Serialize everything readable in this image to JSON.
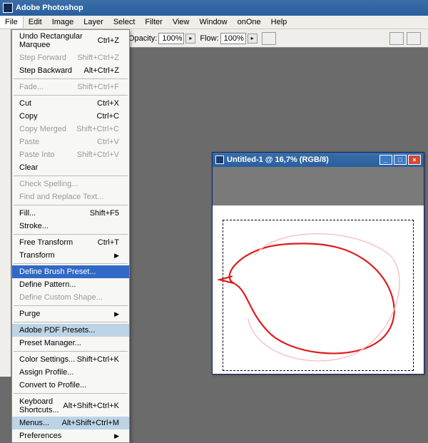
{
  "titlebar": {
    "app_name": "Adobe Photoshop"
  },
  "menubar": {
    "items": [
      "File",
      "Edit",
      "Image",
      "Layer",
      "Select",
      "Filter",
      "View",
      "Window",
      "onOne",
      "Help"
    ]
  },
  "options_bar": {
    "opacity_label": "Opacity:",
    "opacity_value": "100%",
    "flow_label": "Flow:",
    "flow_value": "100%"
  },
  "edit_menu": {
    "items": [
      {
        "label": "Undo Rectangular Marquee",
        "shortcut": "Ctrl+Z",
        "state": "normal"
      },
      {
        "label": "Step Forward",
        "shortcut": "Shift+Ctrl+Z",
        "state": "disabled"
      },
      {
        "label": "Step Backward",
        "shortcut": "Alt+Ctrl+Z",
        "state": "normal"
      },
      {
        "sep": true
      },
      {
        "label": "Fade...",
        "shortcut": "Shift+Ctrl+F",
        "state": "disabled"
      },
      {
        "sep": true
      },
      {
        "label": "Cut",
        "shortcut": "Ctrl+X",
        "state": "normal"
      },
      {
        "label": "Copy",
        "shortcut": "Ctrl+C",
        "state": "normal"
      },
      {
        "label": "Copy Merged",
        "shortcut": "Shift+Ctrl+C",
        "state": "disabled"
      },
      {
        "label": "Paste",
        "shortcut": "Ctrl+V",
        "state": "disabled"
      },
      {
        "label": "Paste Into",
        "shortcut": "Shift+Ctrl+V",
        "state": "disabled"
      },
      {
        "label": "Clear",
        "shortcut": "",
        "state": "normal"
      },
      {
        "sep": true
      },
      {
        "label": "Check Spelling...",
        "shortcut": "",
        "state": "disabled"
      },
      {
        "label": "Find and Replace Text...",
        "shortcut": "",
        "state": "disabled"
      },
      {
        "sep": true
      },
      {
        "label": "Fill...",
        "shortcut": "Shift+F5",
        "state": "normal"
      },
      {
        "label": "Stroke...",
        "shortcut": "",
        "state": "normal"
      },
      {
        "sep": true
      },
      {
        "label": "Free Transform",
        "shortcut": "Ctrl+T",
        "state": "normal"
      },
      {
        "label": "Transform",
        "shortcut": "",
        "state": "normal",
        "submenu": true
      },
      {
        "sep": true
      },
      {
        "label": "Define Brush Preset...",
        "shortcut": "",
        "state": "selected"
      },
      {
        "label": "Define Pattern...",
        "shortcut": "",
        "state": "normal"
      },
      {
        "label": "Define Custom Shape...",
        "shortcut": "",
        "state": "disabled"
      },
      {
        "sep": true
      },
      {
        "label": "Purge",
        "shortcut": "",
        "state": "normal",
        "submenu": true
      },
      {
        "sep": true
      },
      {
        "label": "Adobe PDF Presets...",
        "shortcut": "",
        "state": "highlight"
      },
      {
        "label": "Preset Manager...",
        "shortcut": "",
        "state": "normal"
      },
      {
        "sep": true
      },
      {
        "label": "Color Settings...",
        "shortcut": "Shift+Ctrl+K",
        "state": "normal"
      },
      {
        "label": "Assign Profile...",
        "shortcut": "",
        "state": "normal"
      },
      {
        "label": "Convert to Profile...",
        "shortcut": "",
        "state": "normal"
      },
      {
        "sep": true
      },
      {
        "label": "Keyboard Shortcuts...",
        "shortcut": "Alt+Shift+Ctrl+K",
        "state": "normal"
      },
      {
        "label": "Menus...",
        "shortcut": "Alt+Shift+Ctrl+M",
        "state": "highlight"
      },
      {
        "label": "Preferences",
        "shortcut": "",
        "state": "normal",
        "submenu": true
      }
    ]
  },
  "document": {
    "title": "Untitled-1 @ 16,7% (RGB/8)",
    "window_controls": {
      "min": "_",
      "max": "□",
      "close": "×"
    }
  },
  "colors": {
    "accent": "#3169c6",
    "highlight": "#bcd4e6",
    "stroke_red": "#e01a1a",
    "stroke_pink": "#f5c0c0"
  }
}
